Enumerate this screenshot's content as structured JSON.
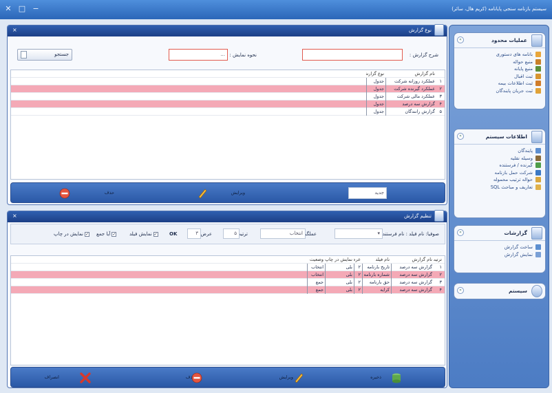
{
  "window": {
    "title": "سیستم بازنامه سنجی پایانامه (کریم هال، سائر)"
  },
  "sidebar": {
    "boxes": [
      {
        "title": "عملیات محدود",
        "items": [
          {
            "label": "بانامه های دستوری",
            "color": "#e8a63a"
          },
          {
            "label": "منبع حواله",
            "color": "#c9812a"
          },
          {
            "label": "منبع پایانه",
            "color": "#5c8f3a"
          },
          {
            "label": "ثبت اقبال",
            "color": "#d7952f"
          },
          {
            "label": "ثبت اطلاعات بیمه",
            "color": "#d07c2a"
          },
          {
            "label": "ثبت جریان پایندگان",
            "color": "#e0a238"
          }
        ]
      },
      {
        "title": "اطلاعات سیستم",
        "items": [
          {
            "label": "پایندگان",
            "color": "#5d8fd0"
          },
          {
            "label": "وسیله نقلیه",
            "color": "#8a6a3a"
          },
          {
            "label": "گیرنده / فرستنده",
            "color": "#4f9d4a"
          },
          {
            "label": "شرکت حمل بازنامه",
            "color": "#3b78c4"
          },
          {
            "label": "حواله ترتیب محموله",
            "color": "#d9a73e"
          },
          {
            "label": "تعاریف و مباحث SQL",
            "color": "#e0b14a"
          }
        ]
      },
      {
        "title": "گزارشات",
        "items": [
          {
            "label": "ساخت گزارش",
            "color": "#5d8fd0"
          },
          {
            "label": "نمایش گزارش",
            "color": "#7aa0d6"
          }
        ]
      },
      {
        "title": "سیستم",
        "items": []
      }
    ]
  },
  "top_panel": {
    "title": "نوع گزارش",
    "fields": {
      "report_desc_label": "شرح گزارش :",
      "report_desc_value": "",
      "display_mode_label": "نحوه نمایش :",
      "display_mode_value": "...",
      "search_label": "جستجو"
    },
    "table": {
      "headers": [
        "نام گزارش",
        "نوع گزارش"
      ],
      "rows": [
        {
          "num": "۱",
          "name": "عملکرد روزانه شرکت",
          "type": "جدول",
          "pink": false
        },
        {
          "num": "۲",
          "name": "عملکرد گیرنده شرکت",
          "type": "جدول",
          "pink": true
        },
        {
          "num": "۳",
          "name": "عملکرد مالی شرکت",
          "type": "جدول",
          "pink": false
        },
        {
          "num": "۴",
          "name": "گزارش سه درصد",
          "type": "جدول",
          "pink": true
        },
        {
          "num": "۵",
          "name": "گزارش رانندگان",
          "type": "جدول",
          "pink": false
        }
      ]
    },
    "actions": {
      "new_value": "جدید",
      "edit_label": "ویرایش",
      "delete_label": "حذف"
    }
  },
  "bottom_panel": {
    "title": "تنظیم گزارش",
    "filter": {
      "field_label": "صوفیا: نام فیلد : نام فرستنده",
      "field_value": "",
      "operator_label": "عملگر :",
      "operator_value": "انتخاب",
      "sort_label": "ترتیب :",
      "sort_value": "۵",
      "width_label": "عرض :",
      "width_value": "۳",
      "ok_label": "OK",
      "cb_nd": "نمایش فیلد",
      "cb_sum": "آیا جمع",
      "cb_print": "نمایش در چاپ"
    },
    "table": {
      "headers": [
        "ترتیب",
        "نام گزارش",
        "نام فیلد",
        "عرض",
        "نمایش در چاپ",
        "وضعیت"
      ],
      "rows": [
        {
          "order": "۱",
          "report": "گزارش سه درصد",
          "field": "تاریخ بارنامه",
          "width": "۲",
          "print": "بلی",
          "status": "انتخاب",
          "pink": false
        },
        {
          "order": "۲",
          "report": "گزارش سه درصد",
          "field": "شماره بارنامه",
          "width": "۲",
          "print": "بلی",
          "status": "انتخاب",
          "pink": true
        },
        {
          "order": "۳",
          "report": "گزارش سه درصد",
          "field": "حق بارنامه",
          "width": "۲",
          "print": "بلی",
          "status": "جمع",
          "pink": false
        },
        {
          "order": "۴",
          "report": "گزارش سه درصد",
          "field": "کرایه",
          "width": "۲",
          "print": "بلی",
          "status": "جمع",
          "pink": true
        }
      ]
    },
    "actions": {
      "save_label": "ذخیره",
      "edit_label": "ویرایش",
      "delete_label": "حذف",
      "cancel_label": "انصراف"
    }
  }
}
